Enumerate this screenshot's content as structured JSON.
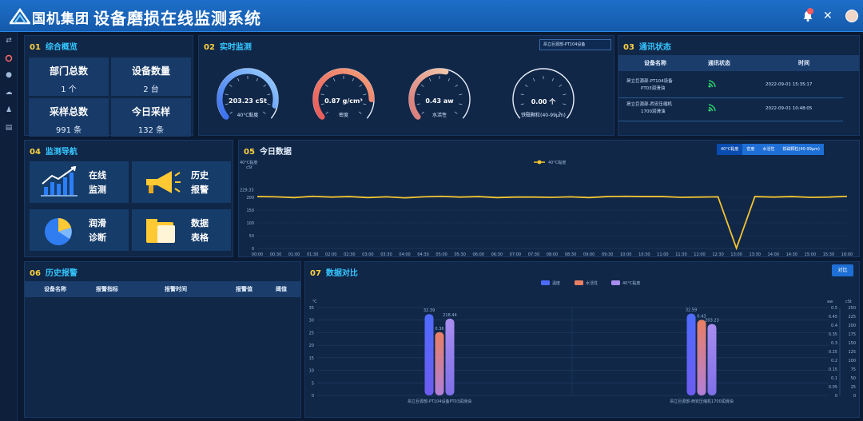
{
  "header": {
    "brand": "国机集团",
    "title": "设备磨损在线监测系统",
    "colors": {
      "bar": "#1766c4",
      "accent": "#36c6ff",
      "section_num": "#ffd23f"
    }
  },
  "rail": {
    "icons": [
      "swap-icon",
      "record-icon",
      "drop-icon",
      "cloud-icon",
      "person-icon",
      "document-icon"
    ]
  },
  "overview": {
    "num": "01",
    "title": "综合概览",
    "stats": [
      {
        "label": "部门总数",
        "value": "1 个"
      },
      {
        "label": "设备数量",
        "value": "2 台"
      },
      {
        "label": "采样总数",
        "value": "991 条"
      },
      {
        "label": "今日采样",
        "value": "132 条"
      }
    ]
  },
  "realtime": {
    "num": "02",
    "title": "实时监测",
    "device_select": "昂立巨源部-PT104设备",
    "gauges": [
      {
        "value": "203.23 cSt",
        "label": "40°C黏度",
        "percent": 0.9,
        "color_from": "#3a6ff0",
        "color_to": "#9ad0ff"
      },
      {
        "value": "0.87 g/cm³",
        "label": "密度",
        "percent": 0.85,
        "color_from": "#e85a5a",
        "color_to": "#f3a07a"
      },
      {
        "value": "0.43 aw",
        "label": "水活性",
        "percent": 0.55,
        "color_from": "#d97a7a",
        "color_to": "#f2c5a8"
      },
      {
        "value": "0.00 个",
        "label": "铁磁颗粒(40-99μm)",
        "percent": 0.0,
        "color_from": "#ffffff",
        "color_to": "#ffffff"
      }
    ]
  },
  "comm": {
    "num": "03",
    "title": "通讯状态",
    "headers": [
      "设备名称",
      "通讯状态",
      "时间"
    ],
    "rows": [
      {
        "name1": "昂立巨源部-PT104设备",
        "name2": "PT03润滑油",
        "time": "2022-09-01 15:35:17"
      },
      {
        "name1": "昂立巨源部-西安压缩机",
        "name2": "1700润滑油",
        "time": "2022-09-01 10:48:05"
      }
    ]
  },
  "nav": {
    "num": "04",
    "title": "监测导航",
    "items": [
      {
        "line1": "在线",
        "line2": "监测"
      },
      {
        "line1": "历史",
        "line2": "报警"
      },
      {
        "line1": "润滑",
        "line2": "诊断"
      },
      {
        "line1": "数据",
        "line2": "表格"
      }
    ]
  },
  "today": {
    "num": "05",
    "title": "今日数据",
    "tabs": [
      "40°C黏度",
      "密度",
      "水活性",
      "铁磁颗粒(40-99μm)"
    ],
    "legend": "40°C黏度",
    "chart_data": {
      "type": "line",
      "title": "",
      "ylabel": "40°C黏度",
      "yunit": "cSt",
      "ylim": [
        0,
        250
      ],
      "yticks": [
        0,
        50,
        100,
        150,
        200
      ],
      "top_tick_label": "229.33",
      "x": [
        "00:00",
        "00:30",
        "01:00",
        "01:30",
        "02:00",
        "02:30",
        "03:00",
        "03:30",
        "04:00",
        "04:30",
        "05:00",
        "05:30",
        "06:00",
        "06:30",
        "07:00",
        "07:30",
        "08:00",
        "08:30",
        "09:00",
        "09:30",
        "10:00",
        "10:30",
        "11:00",
        "11:30",
        "12:00",
        "12:30",
        "13:00",
        "13:30",
        "14:00",
        "14:30",
        "15:00",
        "15:30",
        "16:00"
      ],
      "series": [
        {
          "name": "40°C黏度",
          "color": "#f4c430",
          "values": [
            203,
            202,
            199,
            204,
            201,
            203,
            199,
            202,
            198,
            202,
            204,
            201,
            203,
            199,
            201,
            201,
            200,
            202,
            199,
            203,
            204,
            203,
            203,
            200,
            201,
            202,
            1,
            203,
            201,
            203,
            200,
            201,
            204
          ]
        }
      ]
    }
  },
  "history": {
    "num": "06",
    "title": "历史报警",
    "headers": [
      "设备名称",
      "报警指标",
      "报警时间",
      "报警值",
      "阈值"
    ]
  },
  "compare": {
    "num": "07",
    "title": "数据对比",
    "button": "对比",
    "left_unit": "℃",
    "right_units": [
      "aw",
      "cSt"
    ],
    "chart_data": {
      "type": "bar",
      "title": "",
      "categories": [
        "昂立巨源部-PT104设备PT03润滑油",
        "昂立巨源部-西安压缩机1700润滑油"
      ],
      "series": [
        {
          "name": "温度",
          "color": "#4f6bff",
          "values": [
            32.39,
            32.59
          ]
        },
        {
          "name": "水活性",
          "color": "#ea7f63",
          "values": [
            0.36,
            0.43
          ]
        },
        {
          "name": "40°C黏度",
          "color": "#a98df0",
          "values": [
            218.44,
            203.23
          ]
        }
      ],
      "left_ylim": [
        0,
        35
      ],
      "left_ticks": [
        0,
        5,
        10,
        15,
        20,
        25,
        30,
        35
      ],
      "right_aw_ticks": [
        0,
        0.05,
        0.1,
        0.15,
        0.2,
        0.25,
        0.3,
        0.35,
        0.4,
        0.45,
        0.5
      ],
      "right_cst_ticks": [
        0,
        25,
        50,
        75,
        100,
        125,
        150,
        175,
        200,
        225,
        250
      ]
    }
  }
}
